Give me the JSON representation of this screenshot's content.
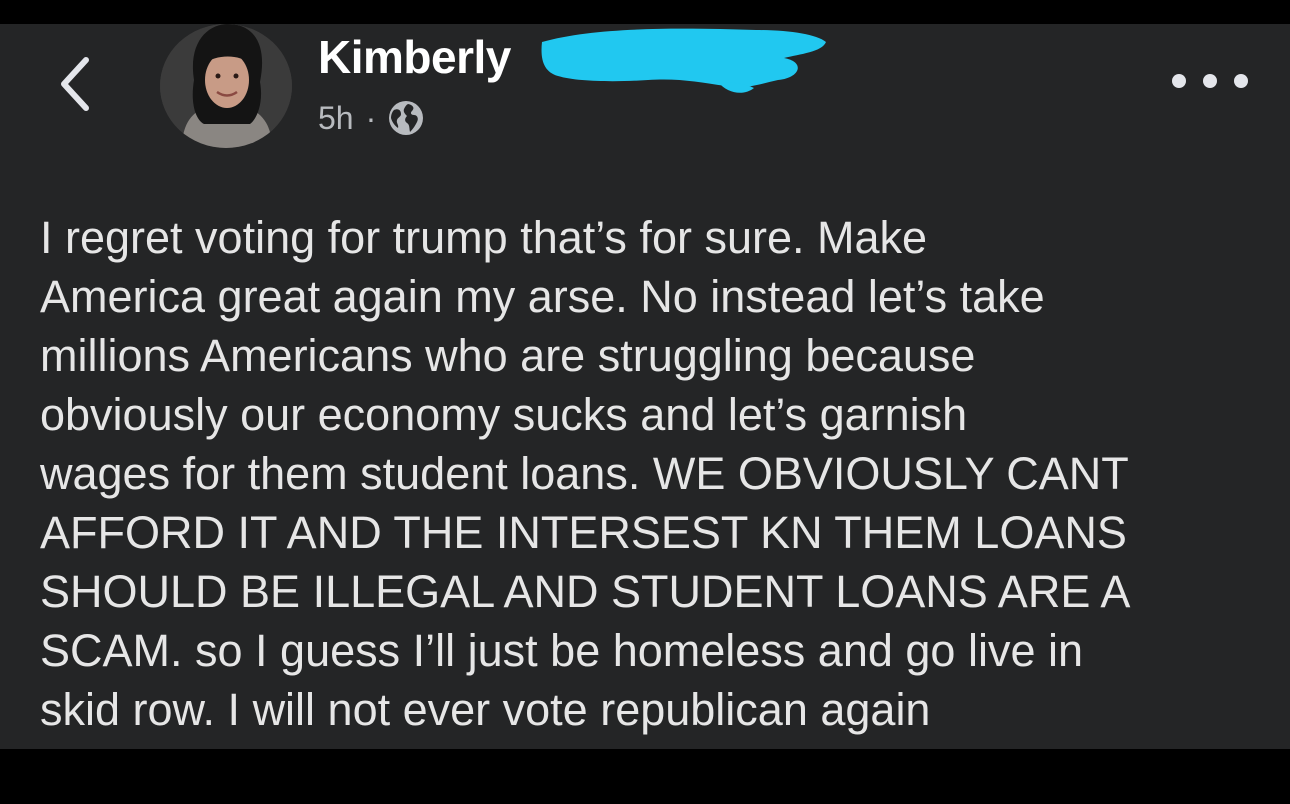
{
  "post": {
    "author_name": "Kimberly",
    "timestamp": "5h",
    "separator": "·",
    "text_lines": [
      "I regret voting for trump that’s for sure. Make",
      "America great again my arse. No instead let’s take",
      "millions Americans who are struggling because",
      "obviously our economy sucks and let’s garnish",
      "wages for them student loans. WE OBVIOUSLY CANT",
      "AFFORD IT AND THE INTERSEST KN THEM LOANS",
      "SHOULD BE ILLEGAL AND STUDENT LOANS ARE A",
      "SCAM. so I guess I’ll just be homeless and go live in",
      "skid row. I will not ever vote republican again"
    ]
  },
  "icons": {
    "back": "chevron-left-icon",
    "audience": "globe-icon",
    "more": "more-horizontal-icon"
  },
  "colors": {
    "background": "#242526",
    "text": "#e6e6e6",
    "meta_text": "#b8bbbf",
    "redaction": "#21c8f0"
  }
}
